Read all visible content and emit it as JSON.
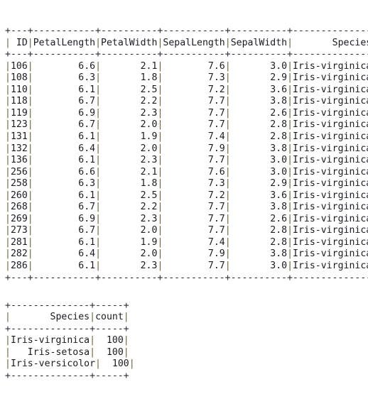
{
  "terminal": {
    "type": "spark-dataframe-show-output",
    "background_color": "#ffffff",
    "text_color": "#18181e",
    "separator_color": "#6b6340"
  },
  "tables": [
    {
      "name": "iris-filtered-rows",
      "columns": [
        {
          "key": "ID",
          "label": "ID",
          "width": 3,
          "align": "right"
        },
        {
          "key": "PetalLength",
          "label": "PetalLength",
          "width": 11,
          "align": "right"
        },
        {
          "key": "PetalWidth",
          "label": "PetalWidth",
          "width": 10,
          "align": "right"
        },
        {
          "key": "SepalLength",
          "label": "SepalLength",
          "width": 11,
          "align": "right"
        },
        {
          "key": "SepalWidth",
          "label": "SepalWidth",
          "width": 10,
          "align": "right"
        },
        {
          "key": "Species",
          "label": "Species",
          "width": 14,
          "align": "right"
        }
      ],
      "rows": [
        [
          "106",
          "6.6",
          "2.1",
          "7.6",
          "3.0",
          "Iris-virginica"
        ],
        [
          "108",
          "6.3",
          "1.8",
          "7.3",
          "2.9",
          "Iris-virginica"
        ],
        [
          "110",
          "6.1",
          "2.5",
          "7.2",
          "3.6",
          "Iris-virginica"
        ],
        [
          "118",
          "6.7",
          "2.2",
          "7.7",
          "3.8",
          "Iris-virginica"
        ],
        [
          "119",
          "6.9",
          "2.3",
          "7.7",
          "2.6",
          "Iris-virginica"
        ],
        [
          "123",
          "6.7",
          "2.0",
          "7.7",
          "2.8",
          "Iris-virginica"
        ],
        [
          "131",
          "6.1",
          "1.9",
          "7.4",
          "2.8",
          "Iris-virginica"
        ],
        [
          "132",
          "6.4",
          "2.0",
          "7.9",
          "3.8",
          "Iris-virginica"
        ],
        [
          "136",
          "6.1",
          "2.3",
          "7.7",
          "3.0",
          "Iris-virginica"
        ],
        [
          "256",
          "6.6",
          "2.1",
          "7.6",
          "3.0",
          "Iris-virginica"
        ],
        [
          "258",
          "6.3",
          "1.8",
          "7.3",
          "2.9",
          "Iris-virginica"
        ],
        [
          "260",
          "6.1",
          "2.5",
          "7.2",
          "3.6",
          "Iris-virginica"
        ],
        [
          "268",
          "6.7",
          "2.2",
          "7.7",
          "3.8",
          "Iris-virginica"
        ],
        [
          "269",
          "6.9",
          "2.3",
          "7.7",
          "2.6",
          "Iris-virginica"
        ],
        [
          "273",
          "6.7",
          "2.0",
          "7.7",
          "2.8",
          "Iris-virginica"
        ],
        [
          "281",
          "6.1",
          "1.9",
          "7.4",
          "2.8",
          "Iris-virginica"
        ],
        [
          "282",
          "6.4",
          "2.0",
          "7.9",
          "3.8",
          "Iris-virginica"
        ],
        [
          "286",
          "6.1",
          "2.3",
          "7.7",
          "3.0",
          "Iris-virginica"
        ]
      ]
    },
    {
      "name": "species-counts",
      "columns": [
        {
          "key": "Species",
          "label": "Species",
          "width": 14,
          "align": "right"
        },
        {
          "key": "count",
          "label": "count",
          "width": 5,
          "align": "right"
        }
      ],
      "rows": [
        [
          "Iris-virginica",
          "100"
        ],
        [
          "Iris-setosa",
          "100"
        ],
        [
          "Iris-versicolor",
          "100"
        ]
      ]
    }
  ]
}
